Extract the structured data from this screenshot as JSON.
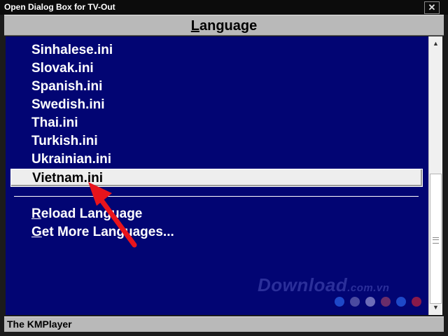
{
  "window": {
    "title": "Open Dialog Box for TV-Out",
    "close_glyph": "✕"
  },
  "header": {
    "first_letter": "L",
    "rest": "anguage"
  },
  "languages": [
    {
      "label": "Sinhalese.ini"
    },
    {
      "label": "Slovak.ini"
    },
    {
      "label": "Spanish.ini"
    },
    {
      "label": "Swedish.ini"
    },
    {
      "label": "Thai.ini"
    },
    {
      "label": "Turkish.ini"
    },
    {
      "label": "Ukrainian.ini"
    },
    {
      "label": "Vietnam.ini",
      "selected": true
    }
  ],
  "actions": {
    "reload": {
      "first_letter": "R",
      "rest": "eload Language"
    },
    "more": {
      "first_letter": "G",
      "rest": "et More Languages..."
    }
  },
  "scrollbar": {
    "up_glyph": "▲",
    "down_glyph": "▼"
  },
  "watermark": {
    "text": "Download",
    "suffix": ".com.vn"
  },
  "watermark_dots": [
    "#1e48c8",
    "#4a4aa0",
    "#6c6cb8",
    "#6a2d6a",
    "#1e48c8",
    "#8a1a4a"
  ],
  "status": {
    "text": "The KMPlayer"
  },
  "colors": {
    "panel_bg": "#020573",
    "highlight": "#eeeeee",
    "annotation_arrow": "#e8141c"
  }
}
